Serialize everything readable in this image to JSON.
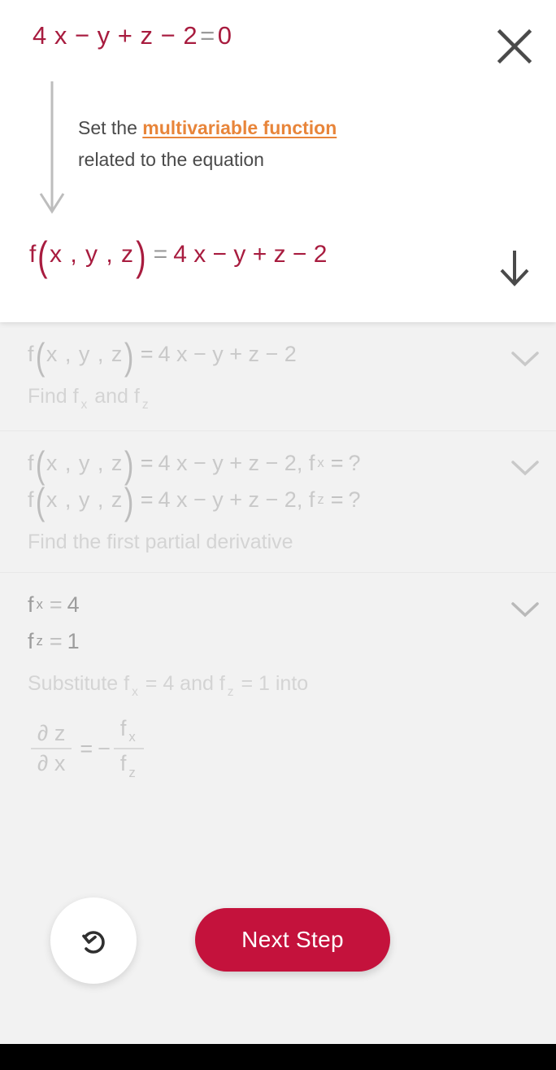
{
  "colors": {
    "accent_crimson": "#a81c3f",
    "button_red": "#c4123c",
    "link_orange": "#e8853a",
    "body_bg": "#f2f2f2",
    "header_bg": "#ffffff",
    "muted_text": "#9d9d9d",
    "faded_text": "#c9c9c9"
  },
  "header": {
    "equation": {
      "lhs": "4 x − y + z − 2",
      "equals": "=",
      "rhs": "0",
      "full": "4x − y + z − 2 = 0"
    },
    "close_icon": "close-icon",
    "hint": {
      "prefix": "Set the ",
      "link": "multivariable function",
      "suffix": "related to the equation",
      "full": "Set the multivariable function related to the equation"
    },
    "result": {
      "fn": "f",
      "open_paren": "(",
      "args": "x , y , z",
      "close_paren": ")",
      "equals": "=",
      "rhs": "4 x − y + z − 2",
      "full": "f(x , y , z) = 4x − y + z − 2"
    },
    "down_icon": "arrow-down-icon"
  },
  "steps": [
    {
      "id": "step-1",
      "chevron_icon": "chevron-down-icon",
      "lines": [
        {
          "fn": "f",
          "args": "x , y , z",
          "equals": "=",
          "rhs": "4 x − y + z − 2",
          "full": "f(x , y , z) = 4x − y + z − 2"
        }
      ],
      "caption_parts": {
        "a": "Find f",
        "sub1": "x",
        "b": " and f",
        "sub2": "z"
      },
      "caption": "Find f x and f z"
    },
    {
      "id": "step-2",
      "chevron_icon": "chevron-down-icon",
      "lines": [
        {
          "fn": "f",
          "args": "x , y , z",
          "equals": "=",
          "rhs": "4 x − y + z − 2",
          "tail_fn": "f",
          "tail_sub": "x",
          "tail_equals": "=",
          "tail_rhs": "?",
          "full": "f(x , y , z) = 4x − y + z − 2 , f x = ?"
        },
        {
          "fn": "f",
          "args": "x , y , z",
          "equals": "=",
          "rhs": "4 x − y + z − 2",
          "tail_fn": "f",
          "tail_sub": "z",
          "tail_equals": "=",
          "tail_rhs": "?",
          "full": "f(x , y , z) = 4x − y + z − 2 , f z = ?"
        }
      ],
      "caption": "Find the first partial derivative"
    },
    {
      "id": "step-3",
      "chevron_icon": "chevron-down-icon",
      "lines": [
        {
          "fn": "f",
          "sub": "x",
          "equals": "=",
          "rhs": "4",
          "full": "f x = 4"
        },
        {
          "fn": "f",
          "sub": "z",
          "equals": "=",
          "rhs": "1",
          "full": "f z = 1"
        }
      ],
      "caption_parts": {
        "a": "Substitute f",
        "sub1": "x",
        "b": " = 4 and f",
        "sub2": "z",
        "c": " = 1 into"
      },
      "caption": "Substitute f x = 4 and f z = 1 into",
      "formula": {
        "lhs_num": "∂ z",
        "lhs_den": "∂ x",
        "equals": "=",
        "minus": "−",
        "rhs_num_fn": "f",
        "rhs_num_sub": "x",
        "rhs_den_fn": "f",
        "rhs_den_sub": "z",
        "full": "∂z / ∂x = − f x / f z"
      }
    }
  ],
  "controls": {
    "undo_icon": "undo-icon",
    "undo_label": "Undo",
    "next_label": "Next Step"
  }
}
